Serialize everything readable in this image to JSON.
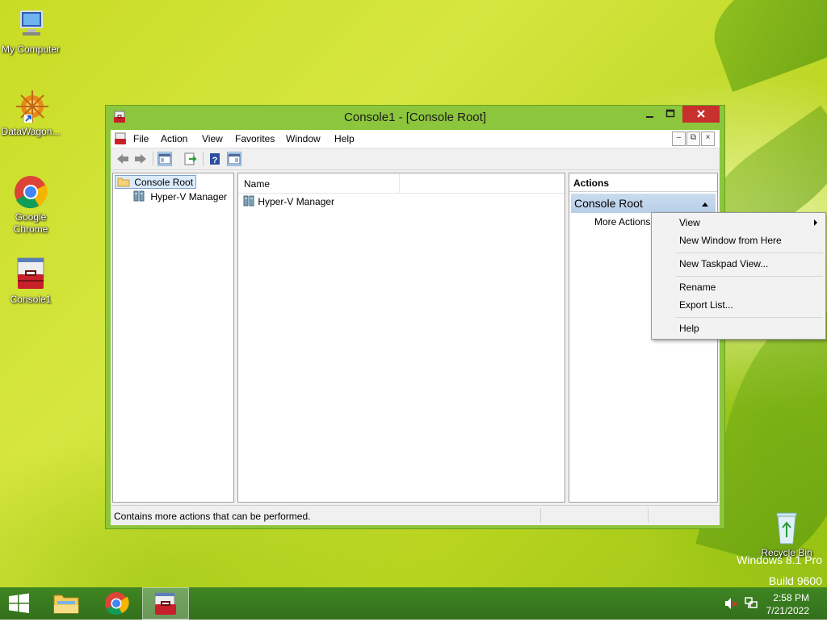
{
  "desktop": {
    "icons": [
      {
        "label": "My Computer",
        "icon": "computer-icon"
      },
      {
        "label": "DataWagon...",
        "icon": "datawagon-icon"
      },
      {
        "label": "Google Chrome",
        "icon": "chrome-icon"
      },
      {
        "label": "Console1",
        "icon": "console-toolbox-icon"
      },
      {
        "label": "Recycle Bin",
        "icon": "recycle-bin-icon"
      }
    ],
    "watermark": {
      "line1": "Windows 8.1 Pro",
      "line2": "Build 9600"
    }
  },
  "window": {
    "title": "Console1 - [Console Root]",
    "menu": [
      "File",
      "Action",
      "View",
      "Favorites",
      "Window",
      "Help"
    ],
    "tree": {
      "root": "Console Root",
      "children": [
        "Hyper-V Manager"
      ]
    },
    "list": {
      "column": "Name",
      "items": [
        "Hyper-V Manager"
      ]
    },
    "actions": {
      "header": "Actions",
      "section": "Console Root",
      "item": "More Actions"
    },
    "status": "Contains more actions that can be performed."
  },
  "context_menu": {
    "items": [
      "View",
      "New Window from Here",
      "New Taskpad View...",
      "Rename",
      "Export List...",
      "Help"
    ]
  },
  "taskbar": {
    "time": "2:58 PM",
    "date": "7/21/2022"
  },
  "colors": {
    "window_frame": "#8cc63c",
    "close_button": "#c7302c",
    "taskbar": "#3f8622",
    "action_header": "#b8cfe8"
  }
}
